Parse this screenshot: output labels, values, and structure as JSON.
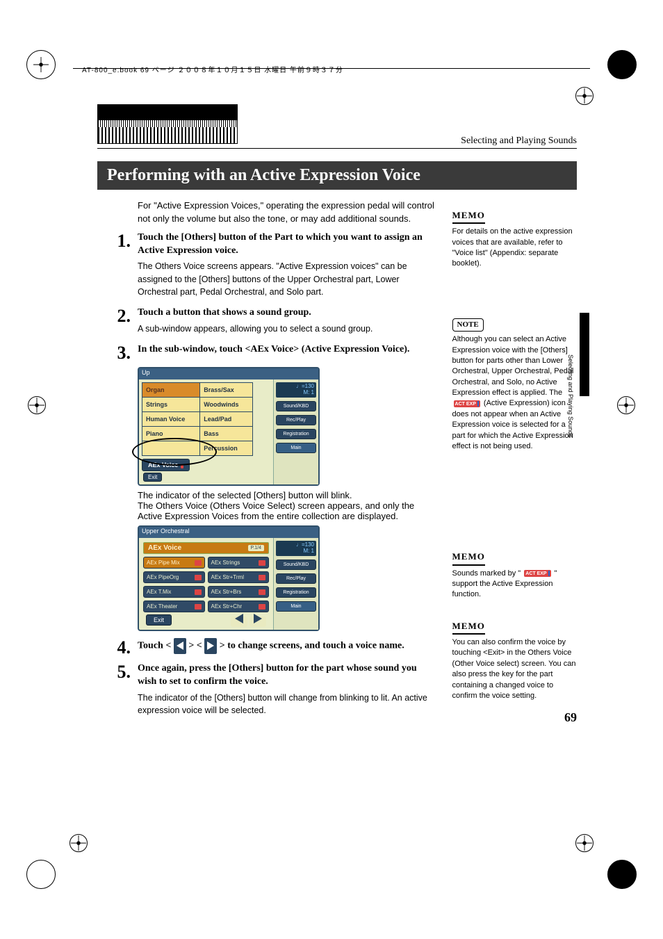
{
  "header_stamp": "AT-800_e.book 69 ページ ２００８年１０月１５日 水曜日 午前９時３７分",
  "breadcrumb": "Selecting and Playing Sounds",
  "section_title": "Performing with an Active Expression Voice",
  "intro": "For \"Active Expression Voices,\" operating the expression pedal will control not only the volume but also the tone, or may add additional sounds.",
  "steps": [
    {
      "num": "1.",
      "title": "Touch the [Others] button of the Part to which you want to assign an Active Expression voice.",
      "desc": "The Others Voice screens appears. \"Active Expression voices\" can be assigned to the [Others] buttons of the Upper Orchestral part, Lower Orchestral part, Pedal Orchestral, and Solo part."
    },
    {
      "num": "2.",
      "title": "Touch a button that shows a sound group.",
      "desc": "A sub-window appears, allowing you to select a sound group."
    },
    {
      "num": "3.",
      "title": "In the sub-window, touch <AEx Voice> (Active Expression Voice).",
      "desc": ""
    },
    {
      "num": "4.",
      "title_pre": "Touch < ",
      "title_mid": " > < ",
      "title_post": " > to change screens, and touch a voice name.",
      "desc": ""
    },
    {
      "num": "5.",
      "title": "Once again, press the [Others] button for the part whose sound you wish to set to confirm the voice.",
      "desc": "The indicator of the [Others] button will change from blinking to lit. An active expression voice will be selected."
    }
  ],
  "after_s1": [
    "The indicator of the selected [Others] button will blink.",
    "The Others Voice (Others Voice Select) screen appears, and only the Active Expression Voices from the entire collection are displayed."
  ],
  "side": {
    "memo1": "For details on the active expression voices that are available, refer to \"Voice list\" (Appendix: separate booklet).",
    "note1_a": "Although you can select an Active Expression voice with the [Others] button for parts other than Lower Orchestral, Upper Orchestral, Pedal Orchestral, and Solo, no Active Expression effect is applied. The ",
    "note1_b": " (Active Expression) icon does not appear when an Active Expression voice is selected for a part for which the Active Expression effect is not being used.",
    "memo2_a": "Sounds marked by \" ",
    "memo2_b": " \" support the Active Expression function.",
    "memo3": "You can also confirm the voice by touching <Exit> in the Others Voice (Other Voice select) screen. You can also press the key for the part containing a changed voice to confirm the voice setting."
  },
  "labels": {
    "memo": "MEMO",
    "note": "NOTE",
    "act": "ACT EXP"
  },
  "screen1": {
    "topbar_l": "Up",
    "tempo": "♩=130",
    "m": "M:    1",
    "groups": [
      [
        "Organ",
        "Brass/Sax"
      ],
      [
        "Strings",
        "Woodwinds"
      ],
      [
        "Human Voice",
        "Lead/Pad"
      ],
      [
        "Piano",
        "Bass"
      ],
      [
        "",
        "Percussion"
      ]
    ],
    "selected": "Organ",
    "aex": "AEx Voice",
    "exit": "Exit",
    "side_labels": [
      "Sound/KBD",
      "Rec/Play",
      "Registration",
      "Main"
    ]
  },
  "screen2": {
    "topbar": "Upper Orchestral",
    "tempo": "♩=130",
    "m": "M:    1",
    "header": "AEx Voice",
    "page": "P.1/4",
    "voices_left": [
      "AEx Pipe Mix",
      "AEx PipeOrg",
      "AEx T.Mix",
      "AEx Theater"
    ],
    "voices_right": [
      "AEx Strings",
      "AEx Str+Trml",
      "AEx Str+Brs",
      "AEx Str+Chr"
    ],
    "selected": "AEx Pipe Mix",
    "exit": "Exit",
    "side_labels": [
      "Sound/KBD",
      "Rec/Play",
      "Registration",
      "Main"
    ]
  },
  "page_num": "69",
  "vtext": "Selecting and Playing Sounds"
}
